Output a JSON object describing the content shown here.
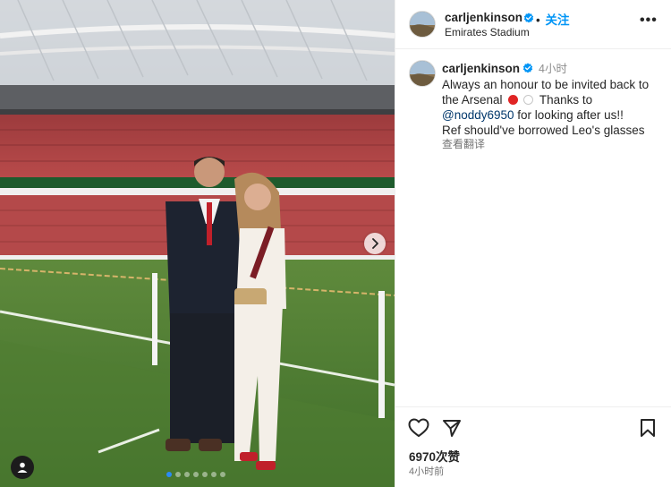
{
  "post": {
    "username": "carljenkinson",
    "follow_separator": "•",
    "follow_label": "关注",
    "location": "Emirates Stadium",
    "more_label": "•••",
    "caption": {
      "time": "4小时",
      "line1": "Always an honour to be invited back to",
      "line2_prefix": "the Arsenal",
      "line2_suffix": "Thanks to",
      "mention": "@noddy6950",
      "line3_suffix": "for looking after us!!",
      "line4": "Ref should've borrowed Leo's glasses",
      "translate": "查看翻译"
    },
    "likes": "6970次赞",
    "post_time": "4小时前"
  },
  "carousel": {
    "slides": 7,
    "active_index": 0
  },
  "icons": {
    "verified": "verified-badge-icon",
    "like": "heart-icon",
    "share": "send-icon",
    "save": "bookmark-icon",
    "next": "chevron-right-icon",
    "tag": "user-tag-icon"
  },
  "colors": {
    "accent": "#0095f6",
    "verified": "#0095f6",
    "active_dot": "#2a8af6"
  }
}
